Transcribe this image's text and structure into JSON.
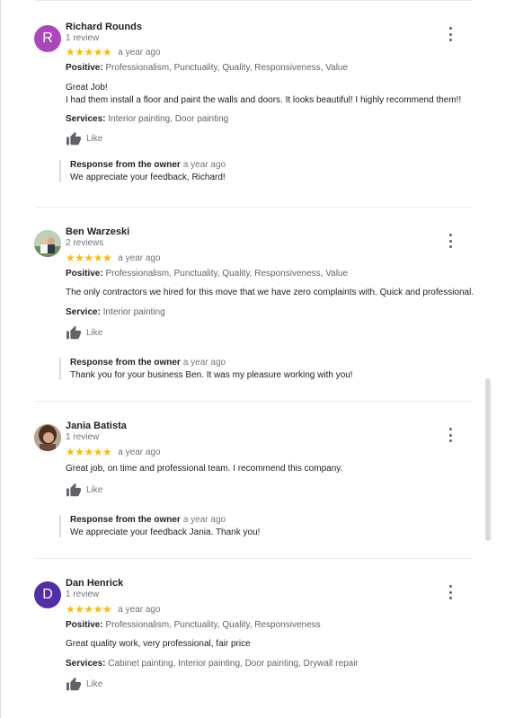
{
  "reviews": [
    {
      "name": "Richard Rounds",
      "count": "1 review",
      "initial": "R",
      "avatar_color": "#ab47bc",
      "stars": "★★★★★",
      "date": "a year ago",
      "positive_label": "Positive:",
      "positive": "Professionalism, Punctuality, Quality, Responsiveness, Value",
      "text_lines": [
        "Great Job!",
        "I had them install a floor and paint the walls and doors. It looks beautiful! I highly recommend them!!"
      ],
      "services_label": "Services:",
      "services": "Interior painting, Door painting",
      "like": "Like",
      "response_label": "Response from the owner",
      "response_date": "a year ago",
      "response_text": "We appreciate your feedback, Richard!"
    },
    {
      "name": "Ben Warzeski",
      "count": "2 reviews",
      "stars": "★★★★★",
      "date": "a year ago",
      "positive_label": "Positive:",
      "positive": "Professionalism, Punctuality, Quality, Responsiveness, Value",
      "text_lines": [
        "The only contractors we hired for this move that we have zero complaints with.  Quick and professional."
      ],
      "services_label": "Service:",
      "services": "Interior painting",
      "like": "Like",
      "response_label": "Response from the owner",
      "response_date": "a year ago",
      "response_text": "Thank you for your business Ben. It was my pleasure working with you!"
    },
    {
      "name": "Jania Batista",
      "count": "1 review",
      "stars": "★★★★★",
      "date": "a year ago",
      "text_lines": [
        "Great job, on time and professional team. I recommend this company."
      ],
      "like": "Like",
      "response_label": "Response from the owner",
      "response_date": "a year ago",
      "response_text": "We appreciate your feedback Jania. Thank you!"
    },
    {
      "name": "Dan Henrick",
      "count": "1 review",
      "initial": "D",
      "avatar_color": "#512da8",
      "stars": "★★★★★",
      "date": "a year ago",
      "positive_label": "Positive:",
      "positive": "Professionalism, Punctuality, Quality, Responsiveness",
      "text_lines": [
        "Great quality work, very professional, fair price"
      ],
      "services_label": "Services:",
      "services": "Cabinet painting, Interior painting, Door painting, Drywall repair",
      "like": "Like"
    }
  ],
  "colors": {
    "star": "#fbbc04",
    "muted": "#70757a",
    "divider": "#ebebeb"
  },
  "icons": {
    "like": "thumbs-up-icon",
    "more": "more-vert-icon"
  }
}
